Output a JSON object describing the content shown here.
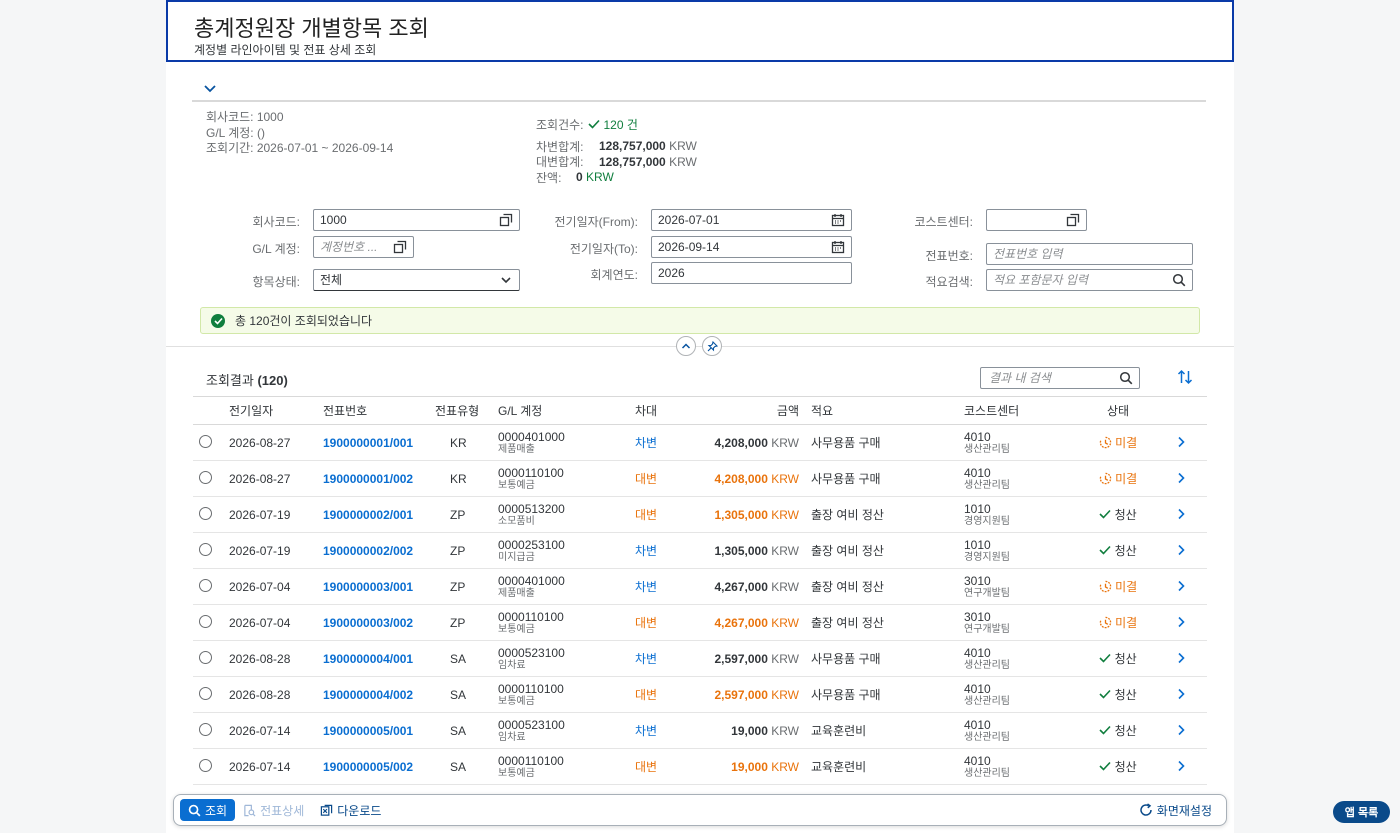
{
  "header": {
    "title": "총계정원장 개별항목 조회",
    "subtitle": "계정별 라인아이템 및 전표 상세 조회"
  },
  "kpi": {
    "company": "회사코드: 1000",
    "gl": "G/L 계정: ()",
    "period": "조회기간: 2026-07-01 ~ 2026-09-14",
    "count_label": "조회건수:",
    "count_value": "120 건",
    "debit_label": "차변합계:",
    "debit_value": "128,757,000",
    "credit_label": "대변합계:",
    "credit_value": "128,757,000",
    "balance_label": "잔액:",
    "balance_value": "0",
    "currency": "KRW"
  },
  "filters": {
    "company_label": "회사코드:",
    "company_value": "1000",
    "gl_label": "G/L 계정:",
    "gl_placeholder": "계정번호 ...",
    "status_label": "항목상태:",
    "status_value": "전체",
    "from_label": "전기일자(From):",
    "from_value": "2026-07-01",
    "to_label": "전기일자(To):",
    "to_value": "2026-09-14",
    "year_label": "회계연도:",
    "year_value": "2026",
    "cc_label": "코스트센터:",
    "doc_label": "전표번호:",
    "doc_placeholder": "전표번호 입력",
    "text_label": "적요검색:",
    "text_placeholder": "적요 포함문자 입력"
  },
  "message": "총 120건이 조회되었습니다",
  "results": {
    "title": "조회결과",
    "count": "(120)",
    "search_placeholder": "결과 내 검색",
    "columns": [
      "전기일자",
      "전표번호",
      "전표유형",
      "G/L 계정",
      "차대",
      "금액",
      "적요",
      "코스트센터",
      "상태"
    ],
    "rows": [
      {
        "date": "2026-08-27",
        "doc": "1900000001/001",
        "type": "KR",
        "gl": "0000401000",
        "gl_name": "제품매출",
        "dc": "차변",
        "amount": "4,208,000",
        "cur": "KRW",
        "text": "사무용품 구매",
        "cc": "4010",
        "cc_name": "생산관리팀",
        "status": "미결"
      },
      {
        "date": "2026-08-27",
        "doc": "1900000001/002",
        "type": "KR",
        "gl": "0000110100",
        "gl_name": "보통예금",
        "dc": "대변",
        "amount": "4,208,000",
        "cur": "KRW",
        "text": "사무용품 구매",
        "cc": "4010",
        "cc_name": "생산관리팀",
        "status": "미결"
      },
      {
        "date": "2026-07-19",
        "doc": "1900000002/001",
        "type": "ZP",
        "gl": "0000513200",
        "gl_name": "소모품비",
        "dc": "대변",
        "amount": "1,305,000",
        "cur": "KRW",
        "text": "출장 여비 정산",
        "cc": "1010",
        "cc_name": "경영지원팀",
        "status": "청산"
      },
      {
        "date": "2026-07-19",
        "doc": "1900000002/002",
        "type": "ZP",
        "gl": "0000253100",
        "gl_name": "미지급금",
        "dc": "차변",
        "amount": "1,305,000",
        "cur": "KRW",
        "text": "출장 여비 정산",
        "cc": "1010",
        "cc_name": "경영지원팀",
        "status": "청산"
      },
      {
        "date": "2026-07-04",
        "doc": "1900000003/001",
        "type": "ZP",
        "gl": "0000401000",
        "gl_name": "제품매출",
        "dc": "차변",
        "amount": "4,267,000",
        "cur": "KRW",
        "text": "출장 여비 정산",
        "cc": "3010",
        "cc_name": "연구개발팀",
        "status": "미결"
      },
      {
        "date": "2026-07-04",
        "doc": "1900000003/002",
        "type": "ZP",
        "gl": "0000110100",
        "gl_name": "보통예금",
        "dc": "대변",
        "amount": "4,267,000",
        "cur": "KRW",
        "text": "출장 여비 정산",
        "cc": "3010",
        "cc_name": "연구개발팀",
        "status": "미결"
      },
      {
        "date": "2026-08-28",
        "doc": "1900000004/001",
        "type": "SA",
        "gl": "0000523100",
        "gl_name": "임차료",
        "dc": "차변",
        "amount": "2,597,000",
        "cur": "KRW",
        "text": "사무용품 구매",
        "cc": "4010",
        "cc_name": "생산관리팀",
        "status": "청산"
      },
      {
        "date": "2026-08-28",
        "doc": "1900000004/002",
        "type": "SA",
        "gl": "0000110100",
        "gl_name": "보통예금",
        "dc": "대변",
        "amount": "2,597,000",
        "cur": "KRW",
        "text": "사무용품 구매",
        "cc": "4010",
        "cc_name": "생산관리팀",
        "status": "청산"
      },
      {
        "date": "2026-07-14",
        "doc": "1900000005/001",
        "type": "SA",
        "gl": "0000523100",
        "gl_name": "임차료",
        "dc": "차변",
        "amount": "19,000",
        "cur": "KRW",
        "text": "교육훈련비",
        "cc": "4010",
        "cc_name": "생산관리팀",
        "status": "청산"
      },
      {
        "date": "2026-07-14",
        "doc": "1900000005/002",
        "type": "SA",
        "gl": "0000110100",
        "gl_name": "보통예금",
        "dc": "대변",
        "amount": "19,000",
        "cur": "KRW",
        "text": "교육훈련비",
        "cc": "4010",
        "cc_name": "생산관리팀",
        "status": "청산"
      }
    ]
  },
  "footer": {
    "search": "조회",
    "detail": "전표상세",
    "download": "다운로드",
    "reset": "화면재설정"
  },
  "app_list": "앱 목록",
  "colors": {
    "brand": "#0a6ed1",
    "open": "#e9730c",
    "done": "#107e3e",
    "title_border": "#0a3aa8"
  }
}
